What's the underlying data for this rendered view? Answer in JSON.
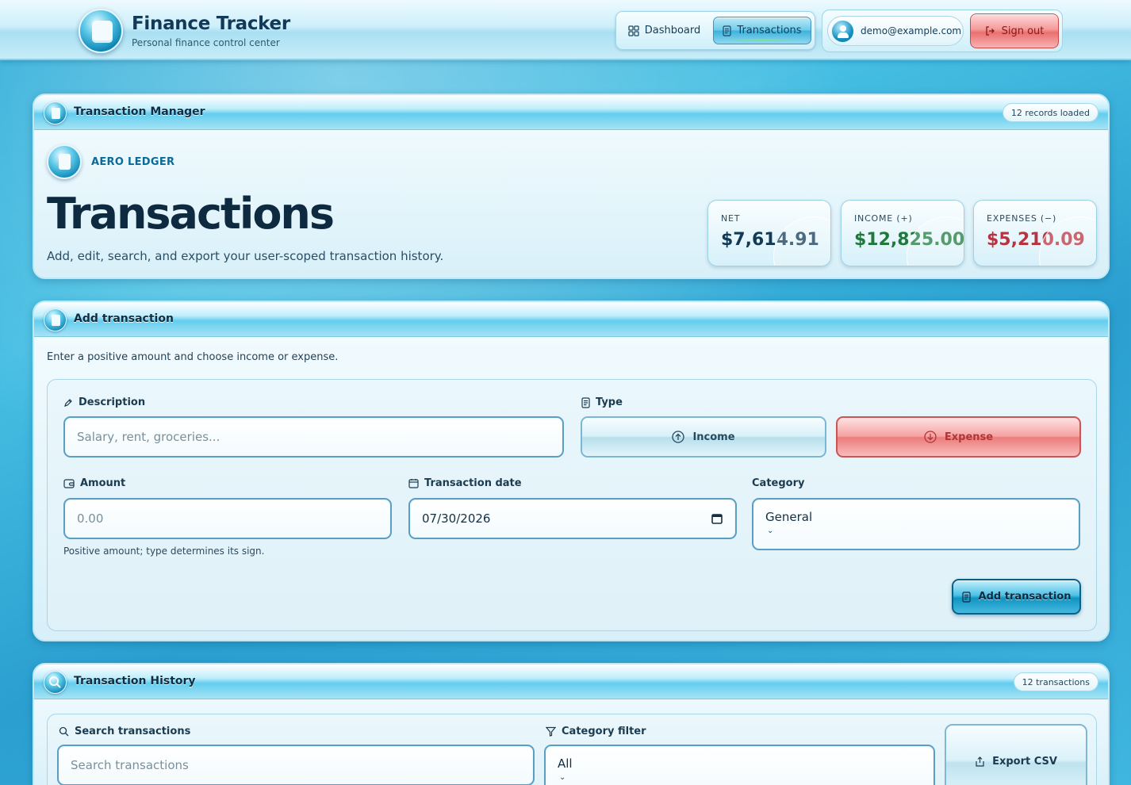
{
  "app": {
    "title": "Finance Tracker",
    "subtitle": "Personal finance control center"
  },
  "nav": {
    "items": [
      {
        "label": "Dashboard",
        "icon": "dashboard-grid-icon",
        "active": false
      },
      {
        "label": "Transactions",
        "icon": "receipt-icon",
        "active": true
      }
    ]
  },
  "user": {
    "email": "demo@example.com",
    "signout_label": "Sign out"
  },
  "manager": {
    "title": "Transaction Manager",
    "badge": "12 records loaded",
    "eyebrow": "AERO LEDGER",
    "heading": "Transactions",
    "description": "Add, edit, search, and export your user-scoped transaction history.",
    "stats": [
      {
        "label": "NET",
        "value": "$7,614.91",
        "color": "#123a56"
      },
      {
        "label": "INCOME (+)",
        "value": "$12,825.00",
        "color": "#1e7a3a"
      },
      {
        "label": "EXPENSES (−)",
        "value": "$5,210.09",
        "color": "#b8333f"
      }
    ]
  },
  "add_form": {
    "title": "Add transaction",
    "hint": "Enter a positive amount and choose income or expense.",
    "description_label": "Description",
    "description_placeholder": "Salary, rent, groceries...",
    "type_label": "Type",
    "income_label": "Income",
    "expense_label": "Expense",
    "selected_type": "Expense",
    "amount_label": "Amount",
    "amount_placeholder": "0.00",
    "amount_help": "Positive amount; type determines its sign.",
    "date_label": "Transaction date",
    "date_value": "07/30/2026",
    "category_label": "Category",
    "category_value": "General",
    "submit_label": "Add transaction"
  },
  "history": {
    "title": "Transaction History",
    "badge": "12 transactions",
    "search_label": "Search transactions",
    "search_placeholder": "Search transactions",
    "category_filter_label": "Category filter",
    "category_filter_value": "All",
    "export_label": "Export CSV"
  },
  "colors": {
    "accent": "#0d86b4",
    "income": "#1e7a3a",
    "expense": "#b8333f"
  }
}
